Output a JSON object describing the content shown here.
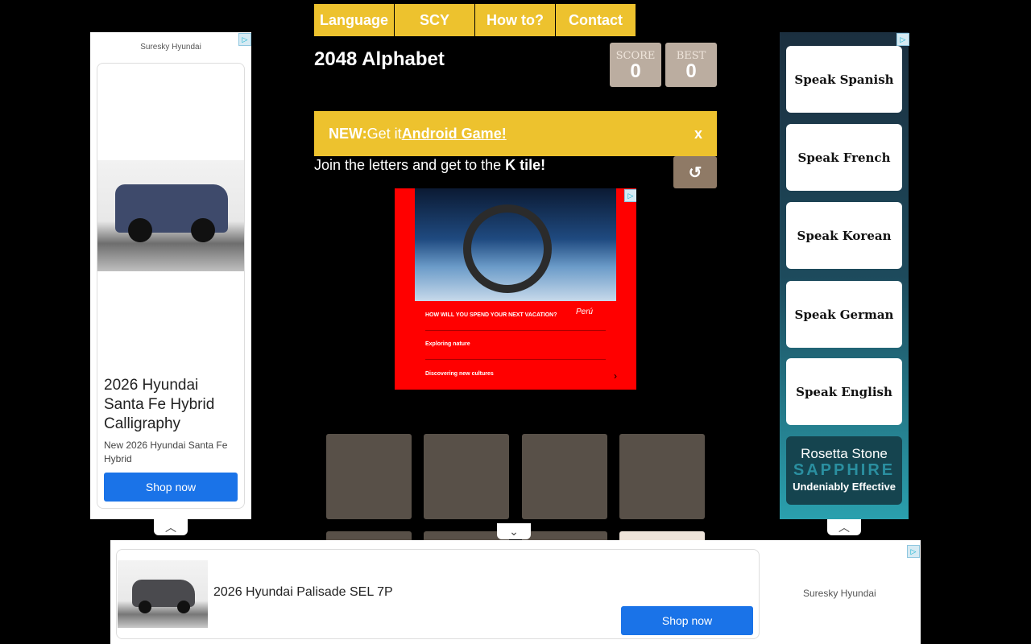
{
  "nav": {
    "items": [
      "Language",
      "SCY",
      "How to?",
      "Contact"
    ]
  },
  "game": {
    "title": "2048 Alphabet",
    "score_label": "SCORE",
    "score": "0",
    "best_label": "BEST",
    "best": "0",
    "banner_new": "NEW:",
    "banner_text": "Get it",
    "banner_link": " Android Game!",
    "banner_close": "x",
    "instr_prefix": "Join the letters and get to the ",
    "instr_bold": "K tile!",
    "undo": "↺"
  },
  "center_ad": {
    "question": "HOW WILL YOU SPEND YOUR NEXT VACATION?",
    "opt1": "Exploring nature",
    "opt2": "Discovering new cultures",
    "logo": "Perú",
    "arrow": "›"
  },
  "left_ad": {
    "advertiser": "Suresky Hyundai",
    "headline": "2026 Hyundai Santa Fe Hybrid Calligraphy",
    "sub": "New 2026 Hyundai Santa Fe Hybrid",
    "cta": "Shop now"
  },
  "right_ad": {
    "items": [
      "Speak Spanish",
      "Speak French",
      "Speak Korean",
      "Speak German",
      "Speak English"
    ],
    "brand": "Rosetta Stone",
    "product": "SAPPHIRE",
    "tagline": "Undeniably Effective"
  },
  "bottom_ad": {
    "headline": "2026 Hyundai Palisade SEL 7P",
    "cta": "Shop now",
    "advertiser": "Suresky Hyundai"
  },
  "icons": {
    "collapse_up": "chevron-up-icon",
    "collapse_down": "chevron-down-icon",
    "adchoices": "adchoices-icon"
  },
  "colors": {
    "accent": "#edc22e",
    "tile_empty": "#585048",
    "score_bg": "#bbada0",
    "button": "#8f7a66",
    "cta_blue": "#1a73e8"
  }
}
